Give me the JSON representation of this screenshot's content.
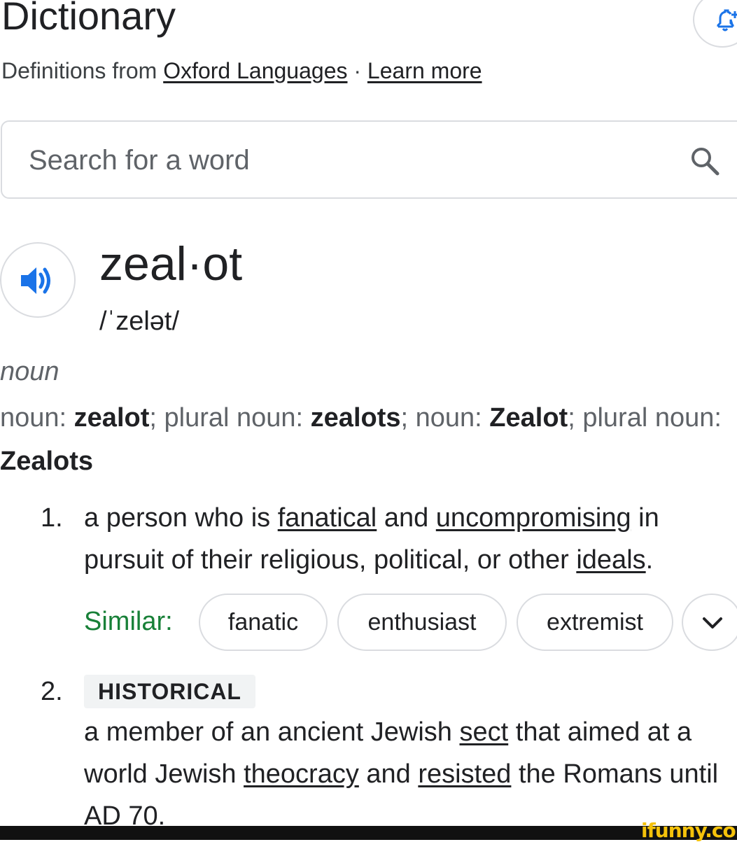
{
  "header": {
    "title": "Dictionary",
    "source_prefix": "Definitions from",
    "source_link": "Oxford Languages",
    "separator": "·",
    "learn_more": "Learn more"
  },
  "search": {
    "placeholder": "Search for a word",
    "value": ""
  },
  "entry": {
    "headword": "zeal·ot",
    "phonetic": "/ˈzelət/",
    "part_of_speech": "noun",
    "forms": [
      {
        "label": "noun",
        "word": "zealot"
      },
      {
        "label": "plural noun",
        "word": "zealots"
      },
      {
        "label": "noun",
        "word": "Zealot"
      },
      {
        "label": "plural noun",
        "word": "Zealots"
      }
    ],
    "definitions": [
      {
        "number": "1.",
        "text_parts": [
          "a person who is ",
          "fanatical",
          " and ",
          "uncompromising",
          " in pursuit of their religious, political, or other ",
          "ideals",
          "."
        ],
        "similar_label": "Similar:",
        "similar": [
          "fanatic",
          "enthusiast",
          "extremist"
        ]
      },
      {
        "number": "2.",
        "tag": "HISTORICAL",
        "text_parts": [
          "a member of an ancient Jewish ",
          "sect",
          " that aimed at a world Jewish ",
          "theocracy",
          " and ",
          "resisted",
          " the Romans until AD 70."
        ]
      }
    ]
  },
  "watermark": "ifunny.co",
  "icons": {
    "bell": "bell-add-icon",
    "search": "search-icon",
    "speaker": "speaker-icon",
    "expand": "chevron-down-icon"
  },
  "colors": {
    "accent_blue": "#1a73e8",
    "similar_green": "#188038",
    "border": "#dadce0",
    "watermark": "#f5c20a"
  }
}
